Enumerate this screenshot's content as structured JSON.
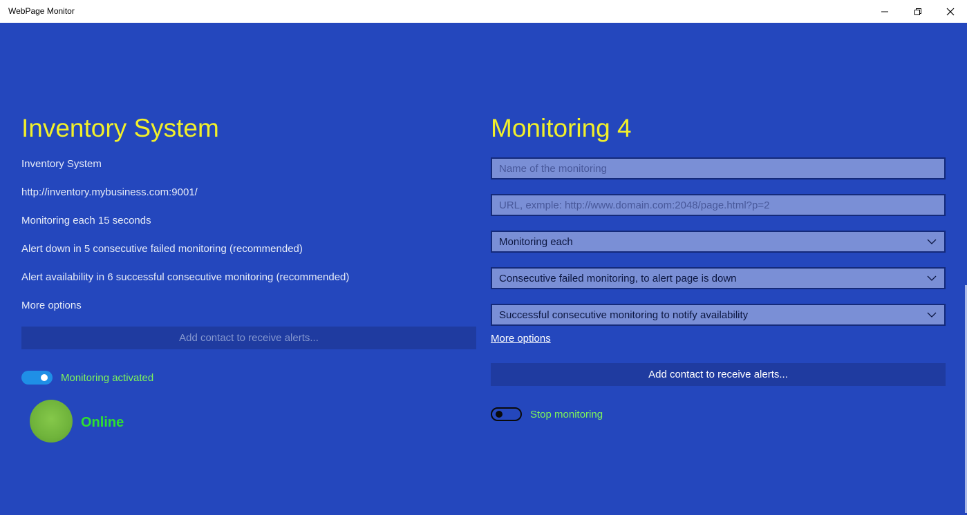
{
  "window": {
    "title": "WebPage Monitor"
  },
  "left": {
    "title": "Inventory System",
    "name": "Inventory System",
    "url": "http://inventory.mybusiness.com:9001/",
    "interval": "Monitoring each 15 seconds",
    "alert_down": "Alert down in 5 consecutive failed monitoring (recommended)",
    "alert_availability": "Alert availability in 6 successful consecutive monitoring (recommended)",
    "more_options": "More options",
    "add_contact": "Add contact to receive alerts...",
    "toggle_label": "Monitoring activated",
    "toggle_on": true,
    "status": "Online",
    "status_color": "#6fb33b"
  },
  "right": {
    "title": "Monitoring 4",
    "name_placeholder": "Name of the monitoring",
    "url_placeholder": "URL, exmple: http://www.domain.com:2048/page.html?p=2",
    "interval_select": "Monitoring each",
    "failed_select": "Consecutive failed monitoring, to alert page is down",
    "success_select": "Successful consecutive monitoring to notify availability",
    "more_options": "More options",
    "add_contact": "Add contact to receive alerts...",
    "toggle_label": "Stop monitoring",
    "toggle_on": false
  },
  "colors": {
    "background": "#2447bd",
    "title_yellow": "#f2f02a",
    "toggle_label_green": "#7ef55a",
    "field_fill": "#7a8fd6"
  },
  "icons": {
    "minimize": "minimize-icon",
    "maximize": "restore-icon",
    "close": "close-icon",
    "dropdown": "chevron-down-icon"
  }
}
